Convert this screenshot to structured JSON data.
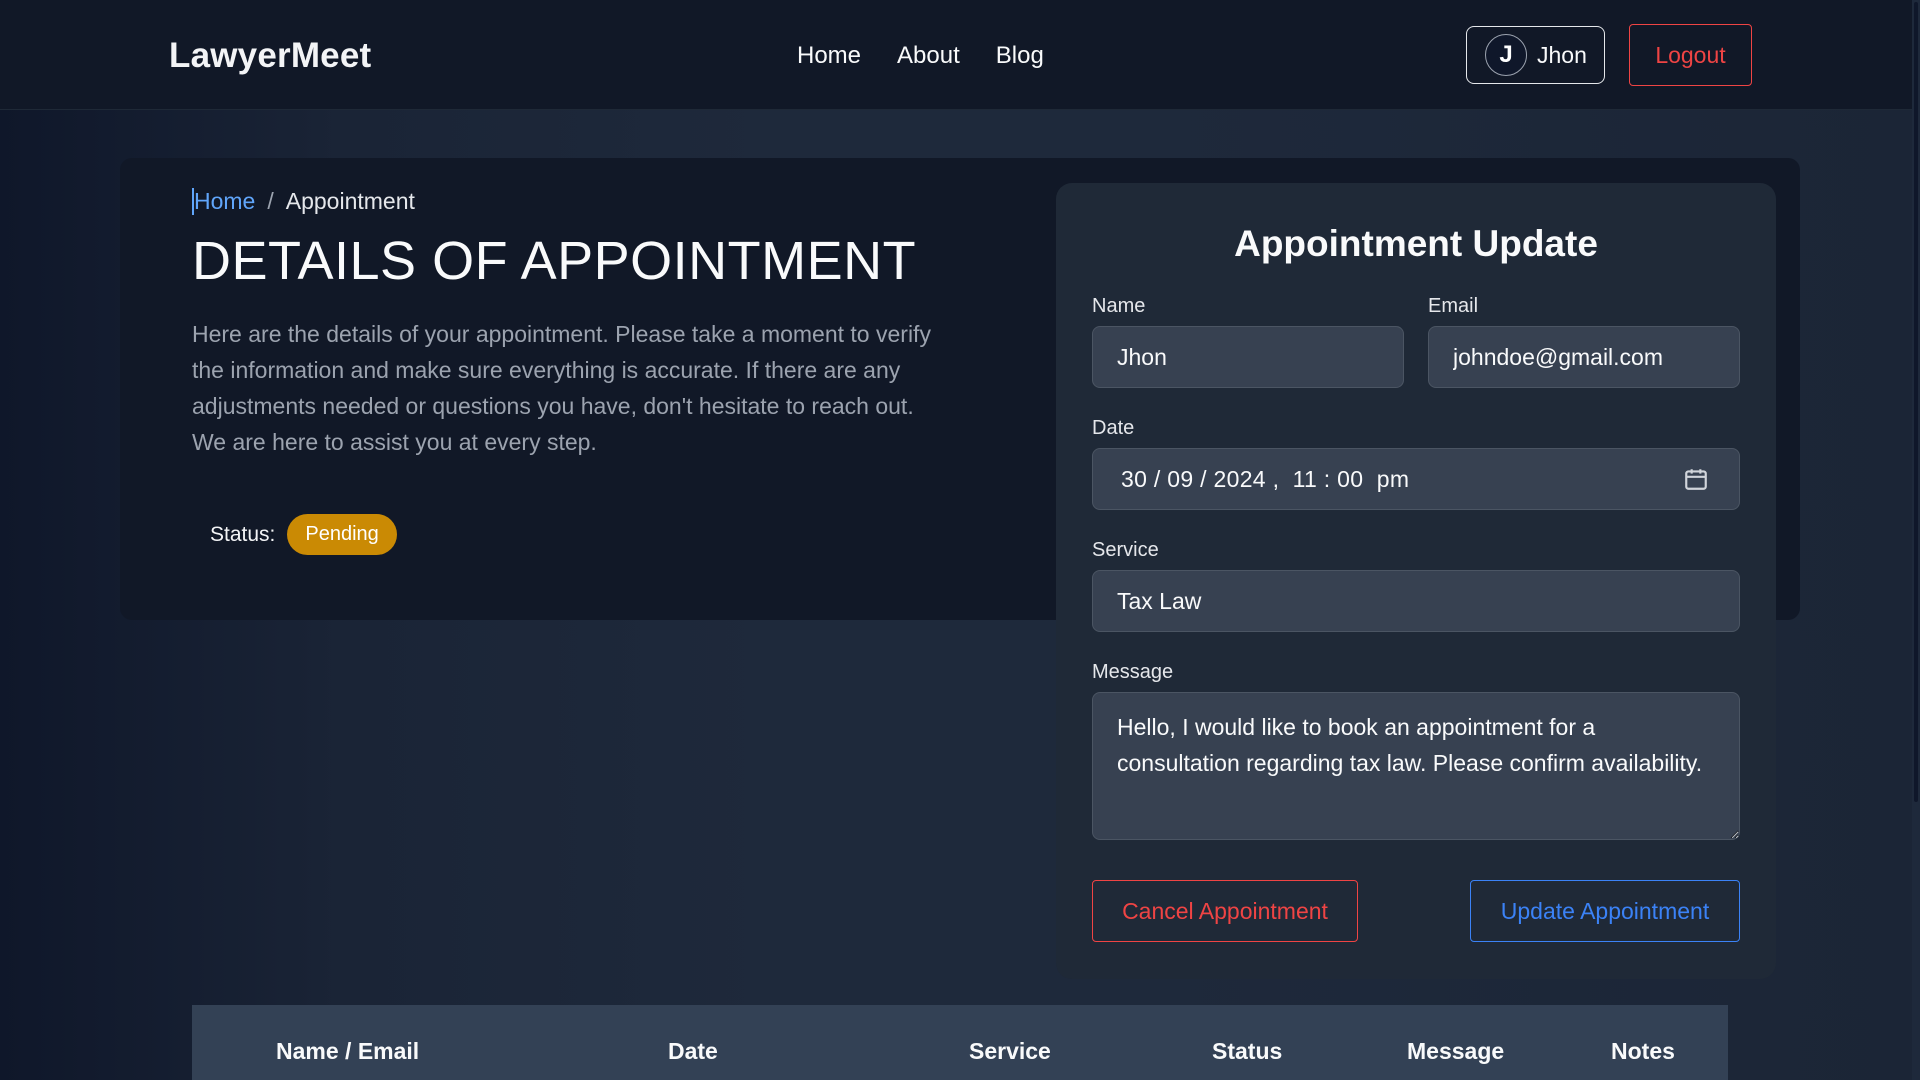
{
  "header": {
    "logo": "LawyerMeet",
    "nav": [
      "Home",
      "About",
      "Blog"
    ],
    "user": {
      "initial": "J",
      "name": "Jhon"
    },
    "logout_label": "Logout"
  },
  "hero": {
    "breadcrumb": {
      "home": "Home",
      "separator": "/",
      "current": "Appointment"
    },
    "title": "DETAILS OF APPOINTMENT",
    "intro": "Here are the details of your appointment. Please take a moment to verify the information and make sure everything is accurate. If there are any adjustments needed or questions you have, don't hesitate to reach out. We are here to assist you at every step.",
    "status_label": "Status:",
    "status_value": "Pending"
  },
  "form": {
    "title": "Appointment Update",
    "name_label": "Name",
    "name_value": "Jhon",
    "email_label": "Email",
    "email_value": "johndoe@gmail.com",
    "date_label": "Date",
    "date_value": "30 / 09 / 2024 ,  11 : 00  pm",
    "service_label": "Service",
    "service_value": "Tax Law",
    "message_label": "Message",
    "message_value": "Hello, I would like to book an appointment for a consultation regarding tax law. Please confirm availability.",
    "cancel_label": "Cancel Appointment",
    "update_label": "Update Appointment"
  },
  "table": {
    "columns": [
      "Name / Email",
      "Date",
      "Service",
      "Status",
      "Message",
      "Notes"
    ]
  },
  "colors": {
    "accent_blue": "#3b82f6",
    "danger_red": "#ef4444",
    "pending_badge": "#ca8a04"
  }
}
